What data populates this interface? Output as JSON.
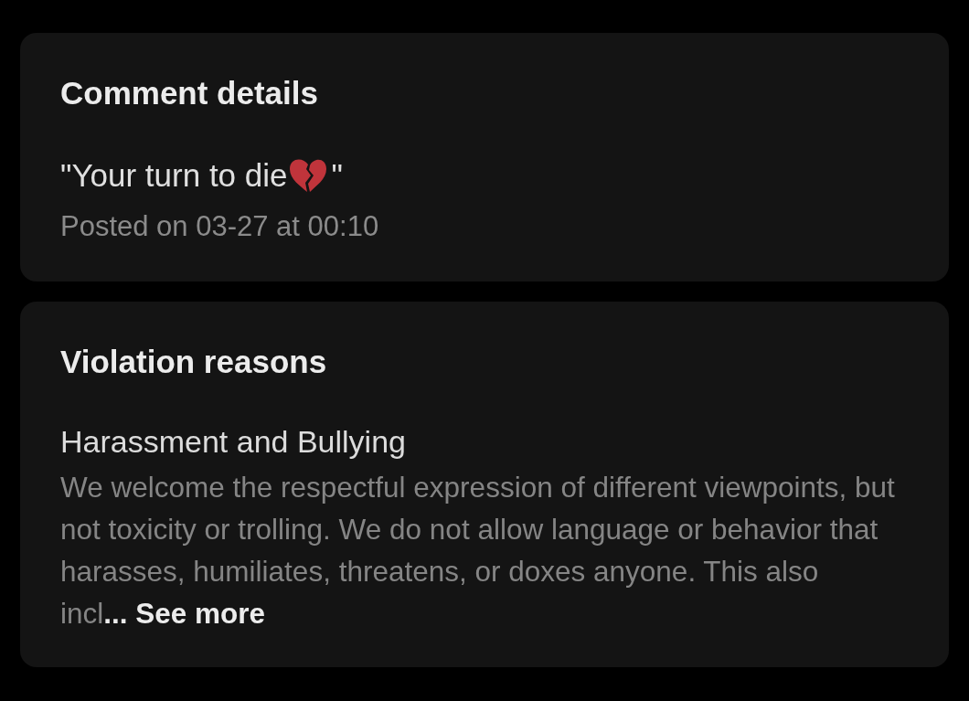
{
  "comment_details": {
    "title": "Comment details",
    "comment_start": "\"Your turn to die ",
    "comment_end": "\"",
    "posted": "Posted on 03-27 at 00:10"
  },
  "violation_reasons": {
    "title": "Violation reasons",
    "reason": "Harassment and Bullying",
    "description": "We welcome the respectful expression of different viewpoints, but not toxicity or trolling. We do not allow language or behavior that harasses, humiliates, threatens, or doxes anyone. This also incl",
    "ellipsis": "...",
    "see_more": "See more"
  }
}
